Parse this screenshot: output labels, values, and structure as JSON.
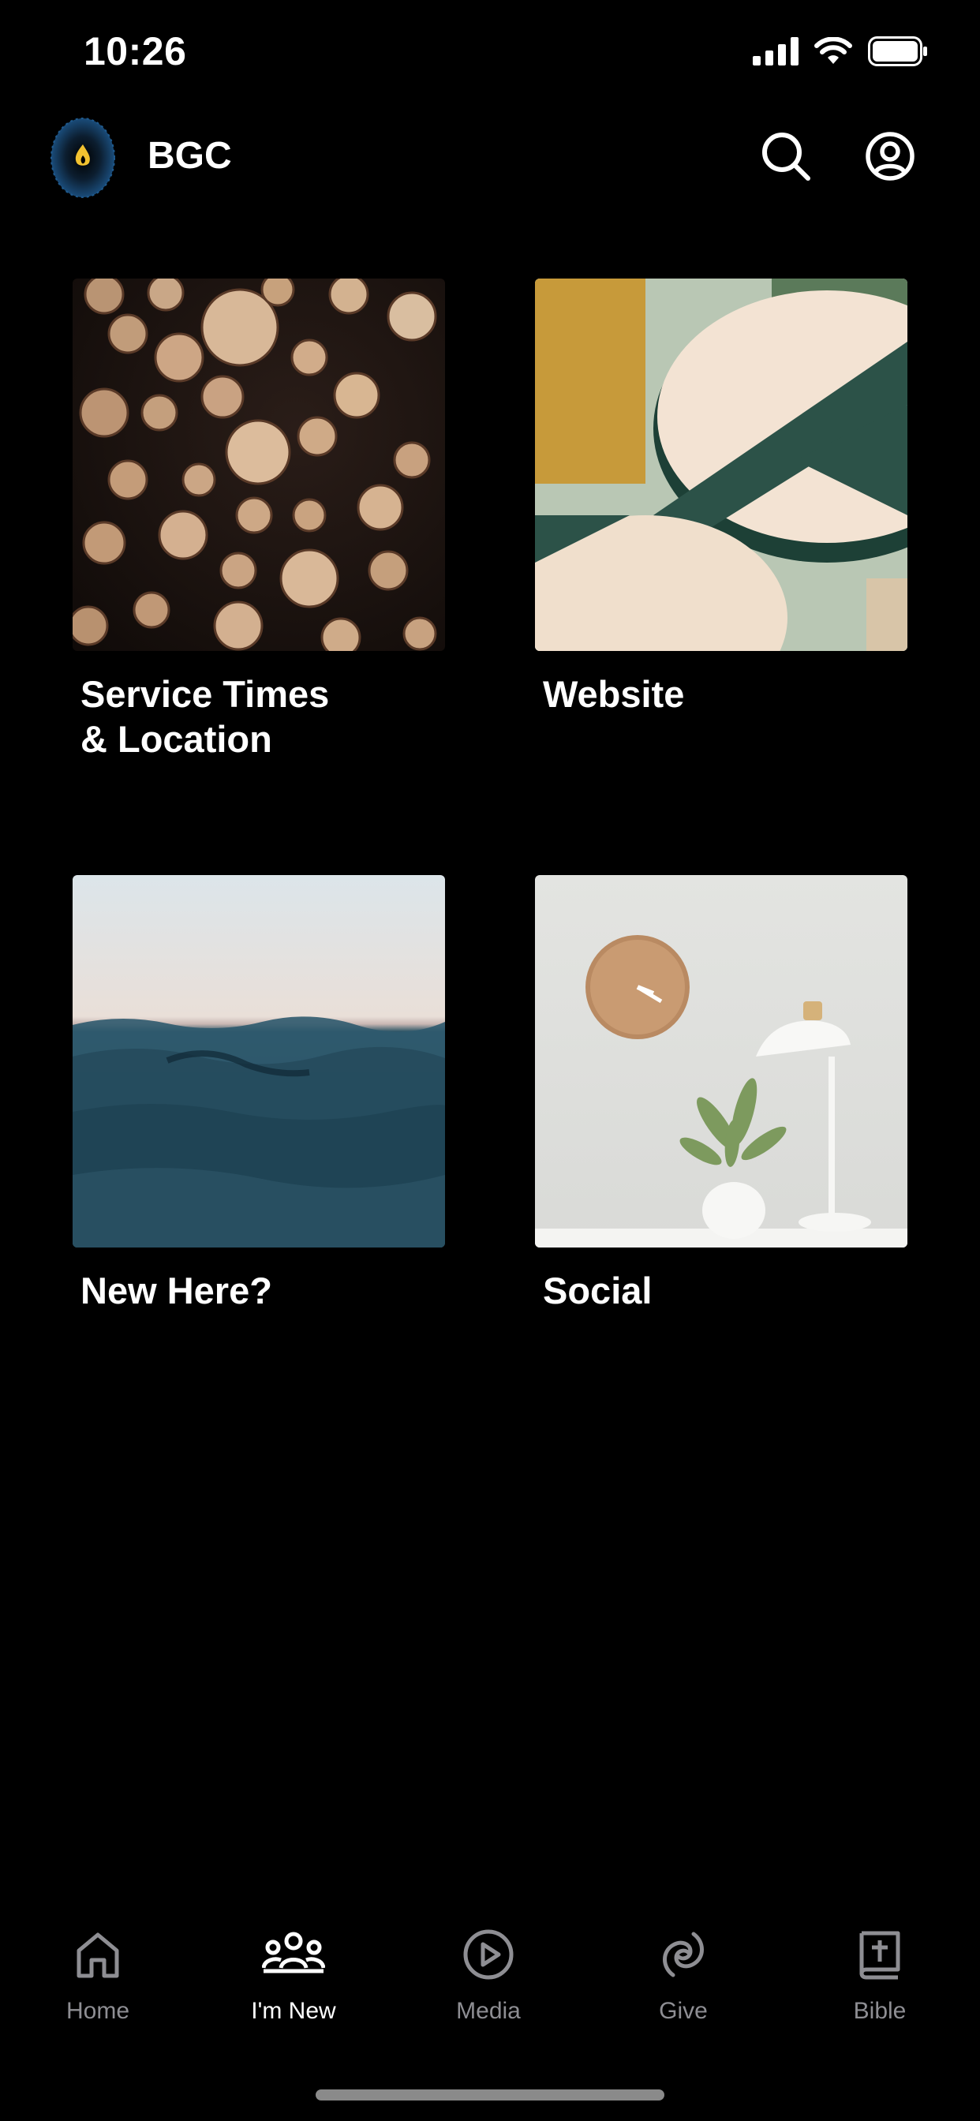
{
  "status_bar": {
    "time": "10:26"
  },
  "header": {
    "title": "BGC",
    "logo_colors": {
      "ring": "#1a4c7a",
      "flame": "#f2c230"
    }
  },
  "tiles": [
    {
      "label": "Service Times\n& Location",
      "image": "stacked-logs"
    },
    {
      "label": "Website",
      "image": "round-table"
    },
    {
      "label": "New Here?",
      "image": "ocean-water"
    },
    {
      "label": "Social",
      "image": "clock-plant-lamp"
    }
  ],
  "bottom_nav": {
    "items": [
      {
        "label": "Home",
        "icon": "home-icon",
        "active": false
      },
      {
        "label": "I'm New",
        "icon": "people-icon",
        "active": true
      },
      {
        "label": "Media",
        "icon": "play-circle-icon",
        "active": false
      },
      {
        "label": "Give",
        "icon": "give-icon",
        "active": false
      },
      {
        "label": "Bible",
        "icon": "bible-icon",
        "active": false
      }
    ]
  },
  "colors": {
    "background": "#000000",
    "active": "#ffffff",
    "inactive": "#8e8e93"
  }
}
